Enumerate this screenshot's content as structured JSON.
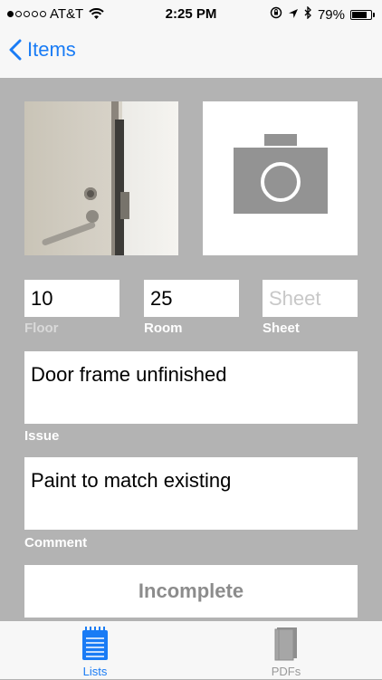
{
  "status_bar": {
    "carrier": "AT&T",
    "signal_bars": 1,
    "time": "2:25 PM",
    "battery_percent": "79%",
    "battery_level": 0.79
  },
  "nav": {
    "back_label": "Items"
  },
  "form": {
    "floor": {
      "value": "10",
      "label": "Floor"
    },
    "room": {
      "value": "25",
      "label": "Room"
    },
    "sheet": {
      "placeholder": "Sheet",
      "label": "Sheet"
    },
    "issue": {
      "value": "Door frame unfinished",
      "label": "Issue"
    },
    "comment": {
      "value": "Paint to match existing",
      "label": "Comment"
    },
    "status_button": "Incomplete"
  },
  "tab_bar": {
    "tabs": [
      {
        "label": "Lists",
        "icon": "notepad-icon",
        "active": true
      },
      {
        "label": "PDFs",
        "icon": "book-icon",
        "active": false
      }
    ]
  },
  "colors": {
    "accent": "#1a7cf5",
    "background": "#b3b3b3",
    "camera_gray": "#939393"
  }
}
